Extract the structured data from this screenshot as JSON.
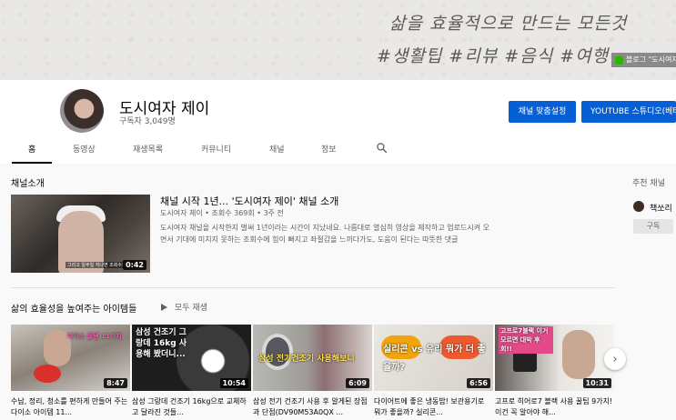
{
  "banner": {
    "line1": "삶을 효율적으로 만드는 모든것",
    "line2": "#생활팁 #리뷰 #음식 #여행",
    "link_label": "블로그 \"도시여자\""
  },
  "channel": {
    "name": "도시여자 제이",
    "subscribers": "구독자 3,049명",
    "customize_button": "채널 맞춤설정",
    "studio_button": "YOUTUBE 스튜디오(베타)"
  },
  "tabs": [
    {
      "label": "홈"
    },
    {
      "label": "동영상"
    },
    {
      "label": "재생목록"
    },
    {
      "label": "커뮤니티"
    },
    {
      "label": "채널"
    },
    {
      "label": "정보"
    }
  ],
  "trailer": {
    "section_title": "채널소개",
    "title": "채널 시작 1년... '도시여자 제이' 채널 소개",
    "meta": "도시여자 제이 • 조회수 369회 • 3주 전",
    "description": "도시여자 채널을 시작한지 벌써 1년이라는 시간이 지났네요. 나름대로 열심히 영상을 제작하고 업로드시켜 오면서 기대에 미치지 못하는 조회수에 힘이 빠지고 좌절감을 느끼다가도, 도움이 된다는 따뜻한 댓글",
    "duration": "0:42",
    "thumb_caption": "그리고 일주일 지나면 조회수가"
  },
  "shelf": {
    "title": "삶의 효율성을 높여주는 아이템들",
    "play_all": "모두 재생",
    "videos": [
      {
        "title": "수납, 정리, 청소를 편하게 만들어 주는 다이소 아이템 11...",
        "duration": "8:47",
        "overlay": "다이소 꿀템 11가지"
      },
      {
        "title": "삼성 그랑데 건조기 16kg으로 교체하고 달라진 것들...",
        "duration": "10:54",
        "overlay": "삼성 건조기 그랑데 16kg 사용해 봤더니..."
      },
      {
        "title": "삼성 전기 건조기 사용 후 알게된 장점과 단점(DV90M53A0QX ...",
        "duration": "6:09",
        "overlay": "삼성 전기건조기 사용해보니"
      },
      {
        "title": "다이어트에 좋은 냉동밥! 보관용기로 뭐가 좋을까? 실리콘...",
        "duration": "6:56",
        "overlay": "실리콘 vs 유리 뭐가 더 좋을까?"
      },
      {
        "title": "고프로 히어로7 블랙 사용 꿀팁 9가지! 이건 꼭 알아야 해...",
        "duration": "10:31",
        "overlay": "고프로7블랙 이거 모르면 대박 후회!!"
      }
    ]
  },
  "featured": {
    "title": "주천 채널",
    "channel_name": "책쏘리",
    "subscribe_label": "구독"
  }
}
